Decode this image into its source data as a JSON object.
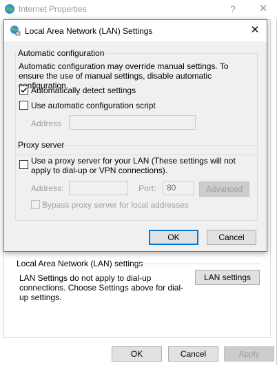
{
  "parent": {
    "title": "Internet Properties",
    "help_glyph": "?",
    "close_glyph": "✕",
    "lan_section_label": "Local Area Network (LAN) settings",
    "lan_note": "LAN Settings do not apply to dial-up connections. Choose Settings above for dial-up settings.",
    "lan_settings_button": "LAN settings",
    "ok_button": "OK",
    "cancel_button": "Cancel",
    "apply_button": "Apply"
  },
  "dialog": {
    "title": "Local Area Network (LAN) Settings",
    "close_glyph": "✕",
    "auto_config": {
      "group_label": "Automatic configuration",
      "description": "Automatic configuration may override manual settings.  To ensure the use of manual settings, disable automatic configuration.",
      "auto_detect_label": "Automatically detect settings",
      "auto_detect_checked": true,
      "use_script_label": "Use automatic configuration script",
      "use_script_checked": false,
      "address_label": "Address",
      "address_value": ""
    },
    "proxy": {
      "group_label": "Proxy server",
      "use_proxy_label": "Use a proxy server for your LAN (These settings will not apply to dial-up or VPN connections).",
      "use_proxy_checked": false,
      "address_label": "Address:",
      "address_value": "",
      "port_label": "Port:",
      "port_value": "80",
      "advanced_button": "Advanced",
      "bypass_label": "Bypass proxy server for local addresses",
      "bypass_checked": false
    },
    "ok_button": "OK",
    "cancel_button": "Cancel"
  },
  "colors": {
    "accent": "#0078d7",
    "dialog_bg": "#f0f0f0",
    "disabled_text": "#a0a0a0"
  }
}
